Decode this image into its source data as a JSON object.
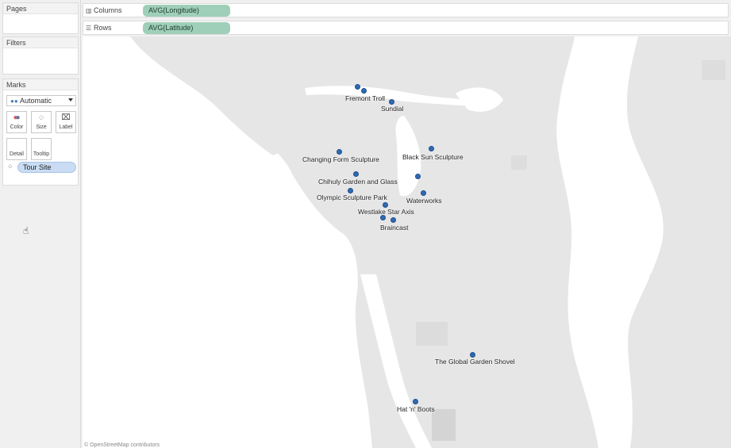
{
  "left_pane": {
    "pages_title": "Pages",
    "filters_title": "Filters",
    "marks_title": "Marks",
    "mark_type": "Automatic",
    "buttons": {
      "color": "Color",
      "size": "Size",
      "label": "Label",
      "detail": "Detail",
      "tooltip": "Tooltip"
    },
    "detail_pill": "Tour Site"
  },
  "shelves": {
    "columns_label": "Columns",
    "columns_pill": "AVG(Longitude)",
    "rows_label": "Rows",
    "rows_pill": "AVG(Latitude)"
  },
  "map": {
    "attribution": "© OpenStreetMap contributors",
    "mark_color": "#2f6ab3",
    "labels": {
      "fremont_troll": "Fremont Troll",
      "sundial": "Sundial",
      "changing_form": "Changing Form Sculpture",
      "black_sun": "Black Sun Sculpture",
      "chihuly": "Chihuly Garden and Glass",
      "olympic": "Olympic Sculpture Park",
      "waterworks": "Waterworks",
      "westlake": "Westlake Star Axis",
      "braincast": "Braincast",
      "garden_shovel": "The Global Garden Shovel",
      "hat_boots": "Hat 'n' Boots"
    }
  }
}
